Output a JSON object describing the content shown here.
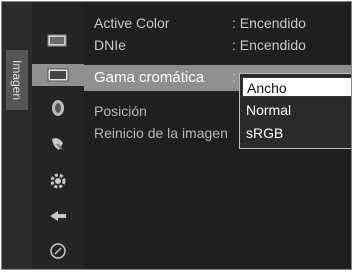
{
  "sidebar": {
    "tab_label": "Imagen"
  },
  "menu": {
    "rows": [
      {
        "label": "Active Color",
        "value": ": Encendido"
      },
      {
        "label": "DNIe",
        "value": ": Encendido"
      },
      {
        "label": "Gama cromática",
        "value": ":"
      },
      {
        "label": "Posición",
        "value": ""
      },
      {
        "label": "Reinicio de la imagen",
        "value": ""
      }
    ]
  },
  "dropdown": {
    "options": [
      "Ancho",
      "Normal",
      "sRGB"
    ],
    "selected": "Ancho"
  },
  "icons": [
    "picture-icon",
    "screen-icon",
    "sound-icon",
    "channel-icon",
    "settings-gear-icon",
    "input-icon",
    "support-icon"
  ]
}
